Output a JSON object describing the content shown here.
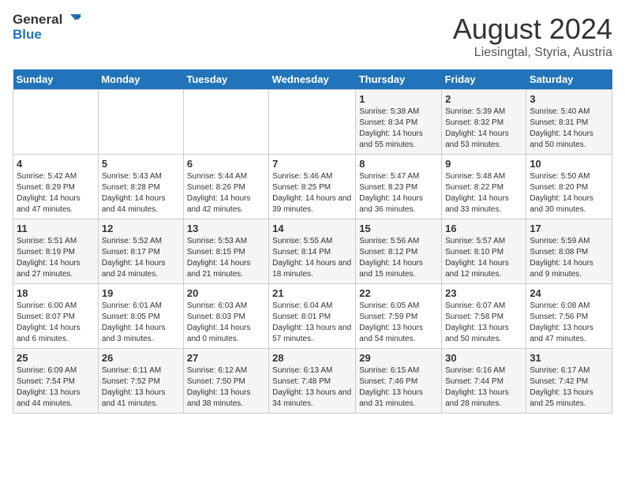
{
  "header": {
    "logo_general": "General",
    "logo_blue": "Blue",
    "title": "August 2024",
    "subtitle": "Liesingtal, Styria, Austria"
  },
  "weekdays": [
    "Sunday",
    "Monday",
    "Tuesday",
    "Wednesday",
    "Thursday",
    "Friday",
    "Saturday"
  ],
  "weeks": [
    {
      "days": [
        {
          "num": "",
          "info": ""
        },
        {
          "num": "",
          "info": ""
        },
        {
          "num": "",
          "info": ""
        },
        {
          "num": "",
          "info": ""
        },
        {
          "num": "1",
          "info": "Sunrise: 5:38 AM\nSunset: 8:34 PM\nDaylight: 14 hours and 55 minutes."
        },
        {
          "num": "2",
          "info": "Sunrise: 5:39 AM\nSunset: 8:32 PM\nDaylight: 14 hours and 53 minutes."
        },
        {
          "num": "3",
          "info": "Sunrise: 5:40 AM\nSunset: 8:31 PM\nDaylight: 14 hours and 50 minutes."
        }
      ]
    },
    {
      "days": [
        {
          "num": "4",
          "info": "Sunrise: 5:42 AM\nSunset: 8:29 PM\nDaylight: 14 hours and 47 minutes."
        },
        {
          "num": "5",
          "info": "Sunrise: 5:43 AM\nSunset: 8:28 PM\nDaylight: 14 hours and 44 minutes."
        },
        {
          "num": "6",
          "info": "Sunrise: 5:44 AM\nSunset: 8:26 PM\nDaylight: 14 hours and 42 minutes."
        },
        {
          "num": "7",
          "info": "Sunrise: 5:46 AM\nSunset: 8:25 PM\nDaylight: 14 hours and 39 minutes."
        },
        {
          "num": "8",
          "info": "Sunrise: 5:47 AM\nSunset: 8:23 PM\nDaylight: 14 hours and 36 minutes."
        },
        {
          "num": "9",
          "info": "Sunrise: 5:48 AM\nSunset: 8:22 PM\nDaylight: 14 hours and 33 minutes."
        },
        {
          "num": "10",
          "info": "Sunrise: 5:50 AM\nSunset: 8:20 PM\nDaylight: 14 hours and 30 minutes."
        }
      ]
    },
    {
      "days": [
        {
          "num": "11",
          "info": "Sunrise: 5:51 AM\nSunset: 8:19 PM\nDaylight: 14 hours and 27 minutes."
        },
        {
          "num": "12",
          "info": "Sunrise: 5:52 AM\nSunset: 8:17 PM\nDaylight: 14 hours and 24 minutes."
        },
        {
          "num": "13",
          "info": "Sunrise: 5:53 AM\nSunset: 8:15 PM\nDaylight: 14 hours and 21 minutes."
        },
        {
          "num": "14",
          "info": "Sunrise: 5:55 AM\nSunset: 8:14 PM\nDaylight: 14 hours and 18 minutes."
        },
        {
          "num": "15",
          "info": "Sunrise: 5:56 AM\nSunset: 8:12 PM\nDaylight: 14 hours and 15 minutes."
        },
        {
          "num": "16",
          "info": "Sunrise: 5:57 AM\nSunset: 8:10 PM\nDaylight: 14 hours and 12 minutes."
        },
        {
          "num": "17",
          "info": "Sunrise: 5:59 AM\nSunset: 8:08 PM\nDaylight: 14 hours and 9 minutes."
        }
      ]
    },
    {
      "days": [
        {
          "num": "18",
          "info": "Sunrise: 6:00 AM\nSunset: 8:07 PM\nDaylight: 14 hours and 6 minutes."
        },
        {
          "num": "19",
          "info": "Sunrise: 6:01 AM\nSunset: 8:05 PM\nDaylight: 14 hours and 3 minutes."
        },
        {
          "num": "20",
          "info": "Sunrise: 6:03 AM\nSunset: 8:03 PM\nDaylight: 14 hours and 0 minutes."
        },
        {
          "num": "21",
          "info": "Sunrise: 6:04 AM\nSunset: 8:01 PM\nDaylight: 13 hours and 57 minutes."
        },
        {
          "num": "22",
          "info": "Sunrise: 6:05 AM\nSunset: 7:59 PM\nDaylight: 13 hours and 54 minutes."
        },
        {
          "num": "23",
          "info": "Sunrise: 6:07 AM\nSunset: 7:58 PM\nDaylight: 13 hours and 50 minutes."
        },
        {
          "num": "24",
          "info": "Sunrise: 6:08 AM\nSunset: 7:56 PM\nDaylight: 13 hours and 47 minutes."
        }
      ]
    },
    {
      "days": [
        {
          "num": "25",
          "info": "Sunrise: 6:09 AM\nSunset: 7:54 PM\nDaylight: 13 hours and 44 minutes."
        },
        {
          "num": "26",
          "info": "Sunrise: 6:11 AM\nSunset: 7:52 PM\nDaylight: 13 hours and 41 minutes."
        },
        {
          "num": "27",
          "info": "Sunrise: 6:12 AM\nSunset: 7:50 PM\nDaylight: 13 hours and 38 minutes."
        },
        {
          "num": "28",
          "info": "Sunrise: 6:13 AM\nSunset: 7:48 PM\nDaylight: 13 hours and 34 minutes."
        },
        {
          "num": "29",
          "info": "Sunrise: 6:15 AM\nSunset: 7:46 PM\nDaylight: 13 hours and 31 minutes."
        },
        {
          "num": "30",
          "info": "Sunrise: 6:16 AM\nSunset: 7:44 PM\nDaylight: 13 hours and 28 minutes."
        },
        {
          "num": "31",
          "info": "Sunrise: 6:17 AM\nSunset: 7:42 PM\nDaylight: 13 hours and 25 minutes."
        }
      ]
    }
  ]
}
